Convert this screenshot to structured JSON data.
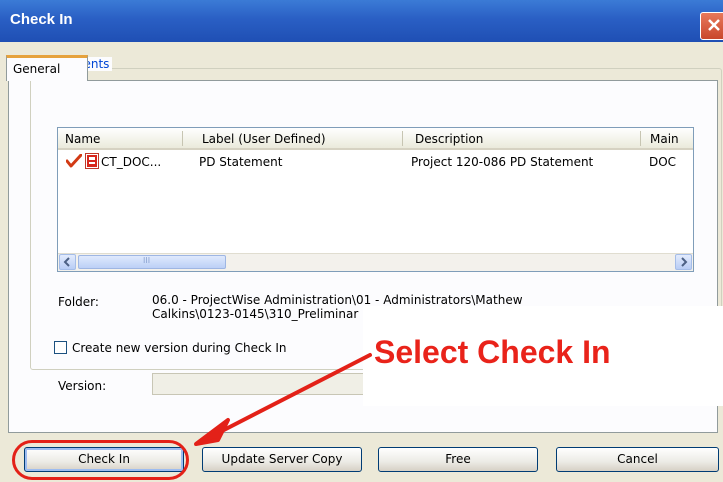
{
  "window": {
    "title": "Check In"
  },
  "tabs": [
    {
      "label": "General"
    }
  ],
  "documents_group": {
    "label": "Documents"
  },
  "columns": [
    "Name",
    "Label (User Defined)",
    "Description",
    "Main"
  ],
  "rows": [
    {
      "name": "CT_DOC...",
      "label": "PD Statement",
      "description": "Project 120-086 PD Statement",
      "main": "DOC"
    }
  ],
  "scrollbar": {
    "thumb_glyph": "III"
  },
  "folder": {
    "label": "Folder:",
    "path_line1": "06.0 - ProjectWise Administration\\01 - Administrators\\Mathew",
    "path_line2": "Calkins\\0123-0145\\310_Preliminar"
  },
  "create_version": {
    "label": "Create new version during Check In",
    "checked": false
  },
  "version": {
    "label": "Version:",
    "value": ""
  },
  "callout": {
    "text": "Select Check In",
    "color": "#e9231a"
  },
  "buttons": {
    "check_in": "Check In",
    "update_server_copy": "Update Server Copy",
    "free": "Free",
    "cancel": "Cancel"
  },
  "colors": {
    "titlebar": "#2a5fc4",
    "accent_tab": "#e6a23c",
    "group_label": "#0046d5",
    "annotation": "#e32118"
  }
}
